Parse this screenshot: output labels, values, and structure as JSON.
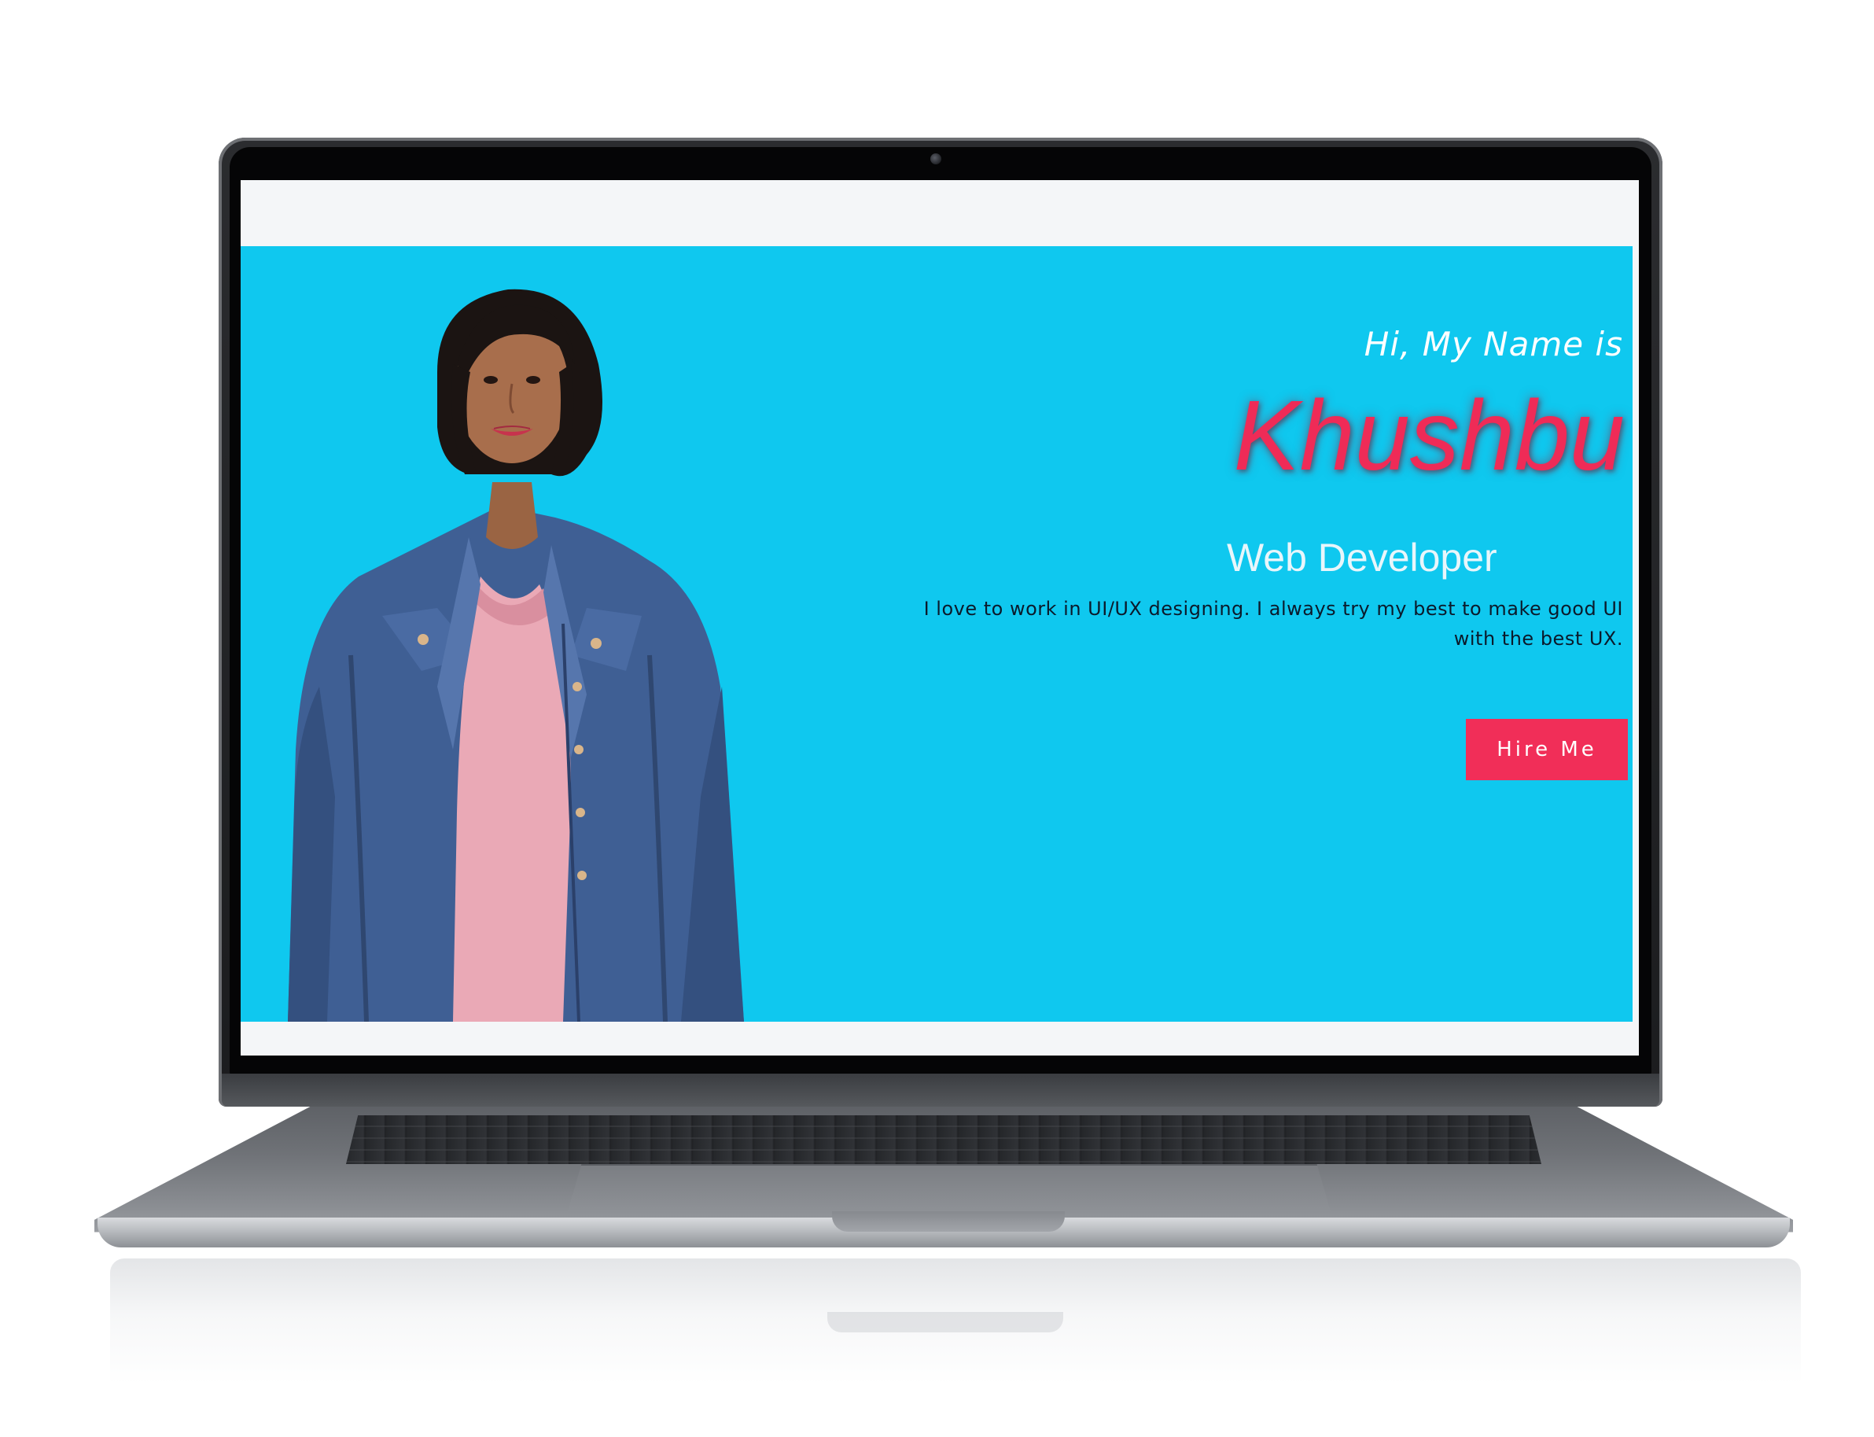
{
  "hero": {
    "greeting": "Hi, My Name is",
    "name": "Khushbu",
    "role": "Web Developer",
    "bio": "I love to work in UI/UX designing. I always try my best to make good UI with the best UX.",
    "hire_label": "Hire Me"
  },
  "colors": {
    "hero_background": "#0fc8ef",
    "accent": "#f12e58",
    "page_background": "#f4f6f8",
    "laptop_bezel": "#050506"
  },
  "icons": {
    "camera": "webcam-icon"
  }
}
